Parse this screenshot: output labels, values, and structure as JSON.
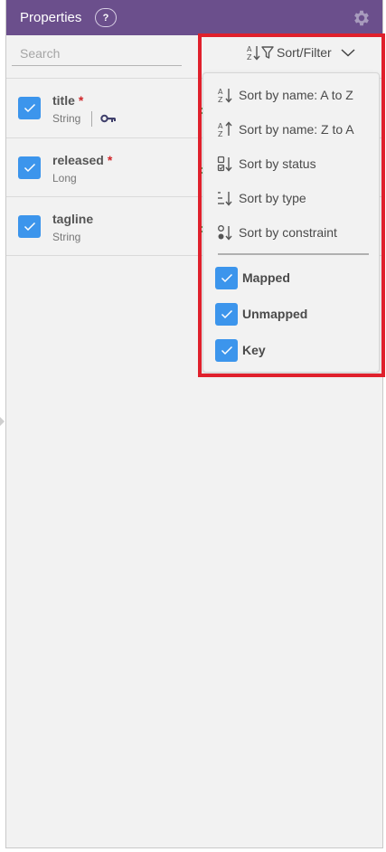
{
  "header": {
    "title": "Properties",
    "help_label": "?",
    "settings_icon": "gear-icon"
  },
  "search": {
    "placeholder": "Search",
    "value": ""
  },
  "sort_filter": {
    "label": "Sort/Filter",
    "icons": [
      "sort-alpha-icon",
      "filter-icon",
      "chevron-down-icon"
    ]
  },
  "properties": [
    {
      "name": "title",
      "type": "String",
      "required": true,
      "required_mark": "*",
      "is_key": true,
      "checked": true
    },
    {
      "name": "released",
      "type": "Long",
      "required": true,
      "required_mark": "*",
      "is_key": false,
      "checked": true
    },
    {
      "name": "tagline",
      "type": "String",
      "required": false,
      "required_mark": "",
      "is_key": false,
      "checked": true
    }
  ],
  "dropdown": {
    "sort_options": [
      {
        "label": "Sort by name: A to Z",
        "icon": "sort-az-icon"
      },
      {
        "label": "Sort by name: Z to A",
        "icon": "sort-za-icon"
      },
      {
        "label": "Sort by status",
        "icon": "sort-status-icon"
      },
      {
        "label": "Sort by type",
        "icon": "sort-type-icon"
      },
      {
        "label": "Sort by constraint",
        "icon": "sort-constraint-icon"
      }
    ],
    "filters": [
      {
        "label": "Mapped",
        "checked": true
      },
      {
        "label": "Unmapped",
        "checked": true
      },
      {
        "label": "Key",
        "checked": true
      }
    ]
  },
  "colors": {
    "header_bg": "#6b4f8c",
    "checkbox": "#3c95ec",
    "required": "#d0262a",
    "highlight_box": "#e0202c",
    "panel_bg": "#f2f2f2"
  }
}
